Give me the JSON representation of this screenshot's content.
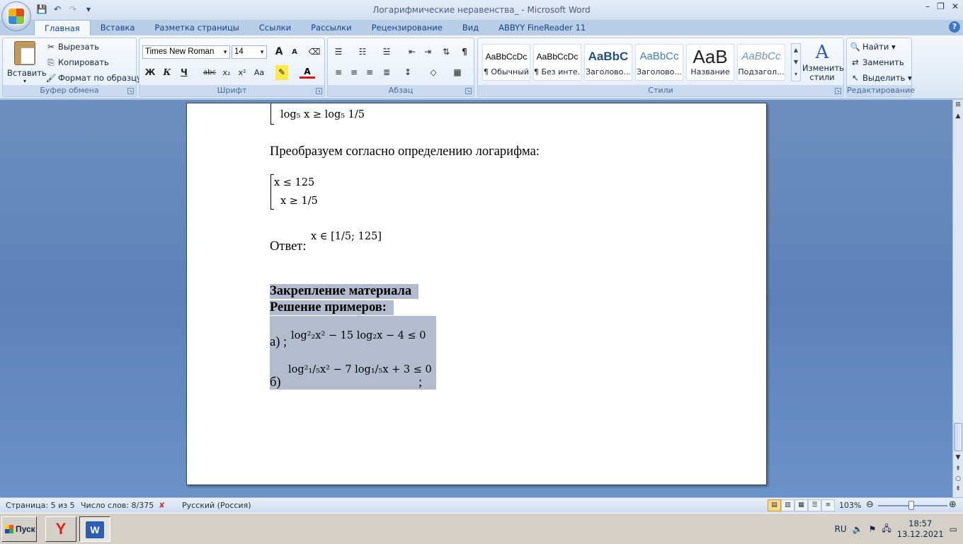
{
  "window": {
    "title": "Логарифмические неравенства_ - Microsoft Word",
    "controls": [
      "–",
      "❐",
      "✕"
    ]
  },
  "qat": {
    "icons": [
      "save-icon",
      "undo-icon",
      "redo-icon",
      "customize-icon"
    ]
  },
  "tabs": [
    "Главная",
    "Вставка",
    "Разметка страницы",
    "Ссылки",
    "Рассылки",
    "Рецензирование",
    "Вид",
    "ABBYY FineReader 11"
  ],
  "ribbon": {
    "clipboard": {
      "label": "Буфер обмена",
      "paste": "Вставить",
      "cut": "Вырезать",
      "copy": "Копировать",
      "format_painter": "Формат по образцу"
    },
    "font": {
      "label": "Шрифт",
      "name": "Times New Roman",
      "size": "14",
      "grow": "A",
      "shrink": "A",
      "bold": "Ж",
      "italic": "К",
      "underline": "Ч",
      "strike": "abc",
      "sub": "x₂",
      "sup": "x²",
      "case": "Aa",
      "color": "A"
    },
    "paragraph": {
      "label": "Абзац"
    },
    "styles": {
      "label": "Стили",
      "items": [
        {
          "sample": "AaBbCcDc",
          "name": "¶ Обычный"
        },
        {
          "sample": "AaBbCcDc",
          "name": "¶ Без инте..."
        },
        {
          "sample": "AaBbC",
          "name": "Заголово..."
        },
        {
          "sample": "AaBbCc",
          "name": "Заголово..."
        },
        {
          "sample": "AaB",
          "name": "Название"
        },
        {
          "sample": "AaBbCc",
          "name": "Подзагол..."
        }
      ],
      "change": "Изменить стили"
    },
    "editing": {
      "label": "Редактирование",
      "find": "Найти",
      "replace": "Заменить",
      "select": "Выделить"
    }
  },
  "document": {
    "line_top_math": "log₅ x ≥ log₅ 1/5",
    "transform_text": "Преобразуем согласно определению логарифма:",
    "system_line1": "x ≤ 125",
    "system_line2": "x ≥ 1/5",
    "answer_label": "Ответ:",
    "answer_math": "x ∈ [1/5; 125]",
    "heading1": "Закрепление материала",
    "heading2": "Решение примеров:",
    "ex_a_label": "а) ;",
    "ex_a_math": "log²₂x² − 15 log₂x − 4 ≤ 0",
    "ex_b_label": "б)",
    "ex_b_math": "log²₁/₅x² − 7 log₁/₅x + 3 ≤ 0",
    "ex_b_tail": ";"
  },
  "status": {
    "page": "Страница: 5 из 5",
    "words": "Число слов: 8/375",
    "language": "Русский (Россия)",
    "zoom": "103%"
  },
  "taskbar": {
    "start": "Пуск",
    "lang": "RU",
    "time": "18:57",
    "date": "13.12.2021"
  }
}
